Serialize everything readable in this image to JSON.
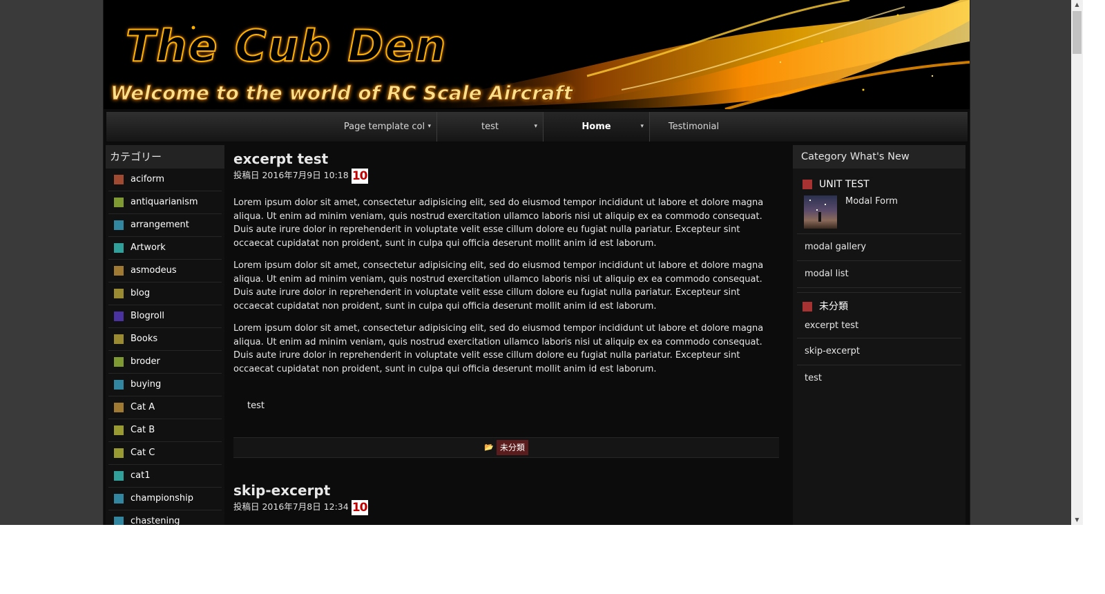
{
  "site": {
    "title": "The Cub Den",
    "tagline": "Welcome to the world of RC Scale Aircraft"
  },
  "colors": {
    "accent_red": "#a83232",
    "banner_gold": "#ffb000",
    "page_bg": "#0c0c0c"
  },
  "nav": {
    "items": [
      {
        "label": "Page template col",
        "has_dropdown": true,
        "active": false
      },
      {
        "label": "test",
        "has_dropdown": true,
        "active": false
      },
      {
        "label": "Home",
        "has_dropdown": true,
        "active": true
      },
      {
        "label": "Testimonial",
        "has_dropdown": false,
        "active": false
      }
    ],
    "dropdown_icon": "chevron-double-down-icon"
  },
  "left_sidebar": {
    "heading": "カテゴリー",
    "categories": [
      {
        "label": "aciform",
        "color": "#a04a32"
      },
      {
        "label": "antiquarianism",
        "color": "#7f9a32"
      },
      {
        "label": "arrangement",
        "color": "#3286a0"
      },
      {
        "label": "Artwork",
        "color": "#32a09a"
      },
      {
        "label": "asmodeus",
        "color": "#a07a32"
      },
      {
        "label": "blog",
        "color": "#9a8a32"
      },
      {
        "label": "Blogroll",
        "color": "#4a32a0"
      },
      {
        "label": "Books",
        "color": "#9a8a32"
      },
      {
        "label": "broder",
        "color": "#7f9a32"
      },
      {
        "label": "buying",
        "color": "#3286a0"
      },
      {
        "label": "Cat A",
        "color": "#a07a32"
      },
      {
        "label": "Cat B",
        "color": "#9a9a32"
      },
      {
        "label": "Cat C",
        "color": "#9a9a32"
      },
      {
        "label": "cat1",
        "color": "#32a09a"
      },
      {
        "label": "championship",
        "color": "#3286a0"
      },
      {
        "label": "chastening",
        "color": "#3286a0"
      }
    ]
  },
  "posts": [
    {
      "title": "excerpt test",
      "meta": "投稿日 2016年7月9日 10:18",
      "badge": "10",
      "paragraphs": [
        "Lorem ipsum dolor sit amet, consectetur adipisicing elit, sed do eiusmod tempor incididunt ut labore et dolore magna aliqua. Ut enim ad minim veniam, quis nostrud exercitation ullamco laboris nisi ut aliquip ex ea commodo consequat. Duis aute irure dolor in reprehenderit in voluptate velit esse cillum dolore eu fugiat nulla pariatur. Excepteur sint occaecat cupidatat non proident, sunt in culpa qui officia deserunt mollit anim id est laborum.",
        "Lorem ipsum dolor sit amet, consectetur adipisicing elit, sed do eiusmod tempor incididunt ut labore et dolore magna aliqua. Ut enim ad minim veniam, quis nostrud exercitation ullamco laboris nisi ut aliquip ex ea commodo consequat. Duis aute irure dolor in reprehenderit in voluptate velit esse cillum dolore eu fugiat nulla pariatur. Excepteur sint occaecat cupidatat non proident, sunt in culpa qui officia deserunt mollit anim id est laborum.",
        "Lorem ipsum dolor sit amet, consectetur adipisicing elit, sed do eiusmod tempor incididunt ut labore et dolore magna aliqua. Ut enim ad minim veniam, quis nostrud exercitation ullamco laboris nisi ut aliquip ex ea commodo consequat. Duis aute irure dolor in reprehenderit in voluptate velit esse cillum dolore eu fugiat nulla pariatur. Excepteur sint occaecat cupidatat non proident, sunt in culpa qui officia deserunt mollit anim id est laborum."
      ],
      "extra": "test",
      "footer_category": "未分類"
    },
    {
      "title": "skip-excerpt",
      "meta": "投稿日 2016年7月8日 12:34",
      "badge": "10"
    }
  ],
  "right_sidebar": {
    "heading": "Category What's New",
    "groups": [
      {
        "title": "UNIT TEST",
        "feature": "Modal Form",
        "links": [
          "modal gallery",
          "modal list"
        ]
      },
      {
        "title": "未分類",
        "links": [
          "excerpt test",
          "skip-excerpt",
          "test"
        ]
      }
    ]
  }
}
